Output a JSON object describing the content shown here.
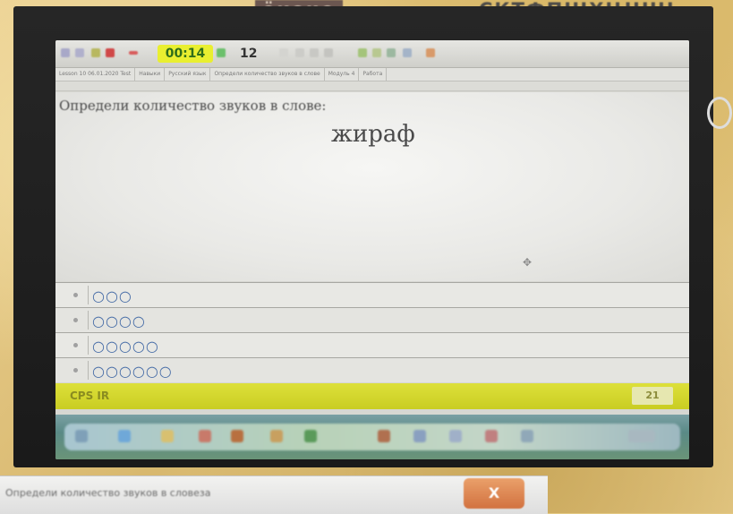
{
  "header": {
    "left_label": "ёкоие",
    "right_label": "СКТФПШХЦЧШЬ"
  },
  "toolbar": {
    "timer": "00:14",
    "counter": "12"
  },
  "nav": {
    "items": [
      "Lesson 10 06.01.2020 Test",
      "Навыки",
      "Русский язык",
      "Определи количество звуков в слове",
      "Модуль 4",
      "Работа"
    ]
  },
  "question": {
    "prompt": "Определи количество звуков в слове:",
    "word": "жираф"
  },
  "answers": [
    {
      "label": "○○○"
    },
    {
      "label": "○○○○"
    },
    {
      "label": "○○○○○"
    },
    {
      "label": "○○○○○○"
    }
  ],
  "status": {
    "left": "CPS IR",
    "score": "21"
  },
  "popup": {
    "title": "Определи количество звуков в словеза",
    "close": "X"
  },
  "colors": {
    "timer_bg": "#e9ef30",
    "status_bar": "#d6d92e",
    "answer_text": "#4a6fa8"
  }
}
